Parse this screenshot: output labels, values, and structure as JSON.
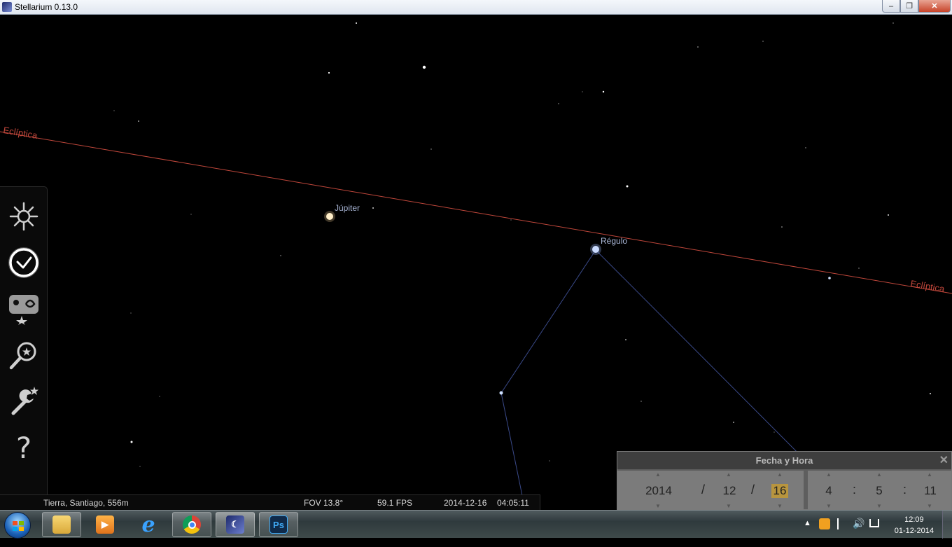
{
  "window": {
    "title": "Stellarium 0.13.0",
    "controls": {
      "minimize": "–",
      "restore": "❐",
      "close": "✕"
    }
  },
  "sky": {
    "labels": {
      "jupiter": "Júpiter",
      "regulus": "Régulo",
      "ecliptic_left": "Eclíptica",
      "ecliptic_right": "Eclíptica"
    },
    "colors": {
      "ecliptic": "#c0473b",
      "constellation": "#3a4a8a",
      "label": "#a9b6d6"
    }
  },
  "left_toolbar": {
    "items": [
      {
        "name": "sky-and-viewing-options-icon"
      },
      {
        "name": "date-time-icon"
      },
      {
        "name": "deep-sky-objects-icon"
      },
      {
        "name": "search-icon"
      },
      {
        "name": "configuration-icon"
      },
      {
        "name": "help-icon",
        "glyph": "?"
      }
    ]
  },
  "status_bar": {
    "location": "Tierra, Santiago, 556m",
    "fov": "FOV 13.8°",
    "fps": "59.1 FPS",
    "date": "2014-12-16",
    "time": "04:05:11"
  },
  "date_time_panel": {
    "title": "Fecha y Hora",
    "close": "✕",
    "year": "2014",
    "month": "12",
    "day": "16",
    "hour": "4",
    "minute": "5",
    "second": "11",
    "date_sep": "/",
    "time_sep": ":"
  },
  "taskbar": {
    "apps": [
      {
        "name": "windows-explorer"
      },
      {
        "name": "media-player"
      },
      {
        "name": "internet-explorer",
        "glyph": "e"
      },
      {
        "name": "chrome"
      },
      {
        "name": "stellarium"
      },
      {
        "name": "photoshop",
        "glyph": "Ps"
      }
    ],
    "tray_expand": "▲",
    "clock_time": "12:09",
    "clock_date": "01-12-2014"
  }
}
